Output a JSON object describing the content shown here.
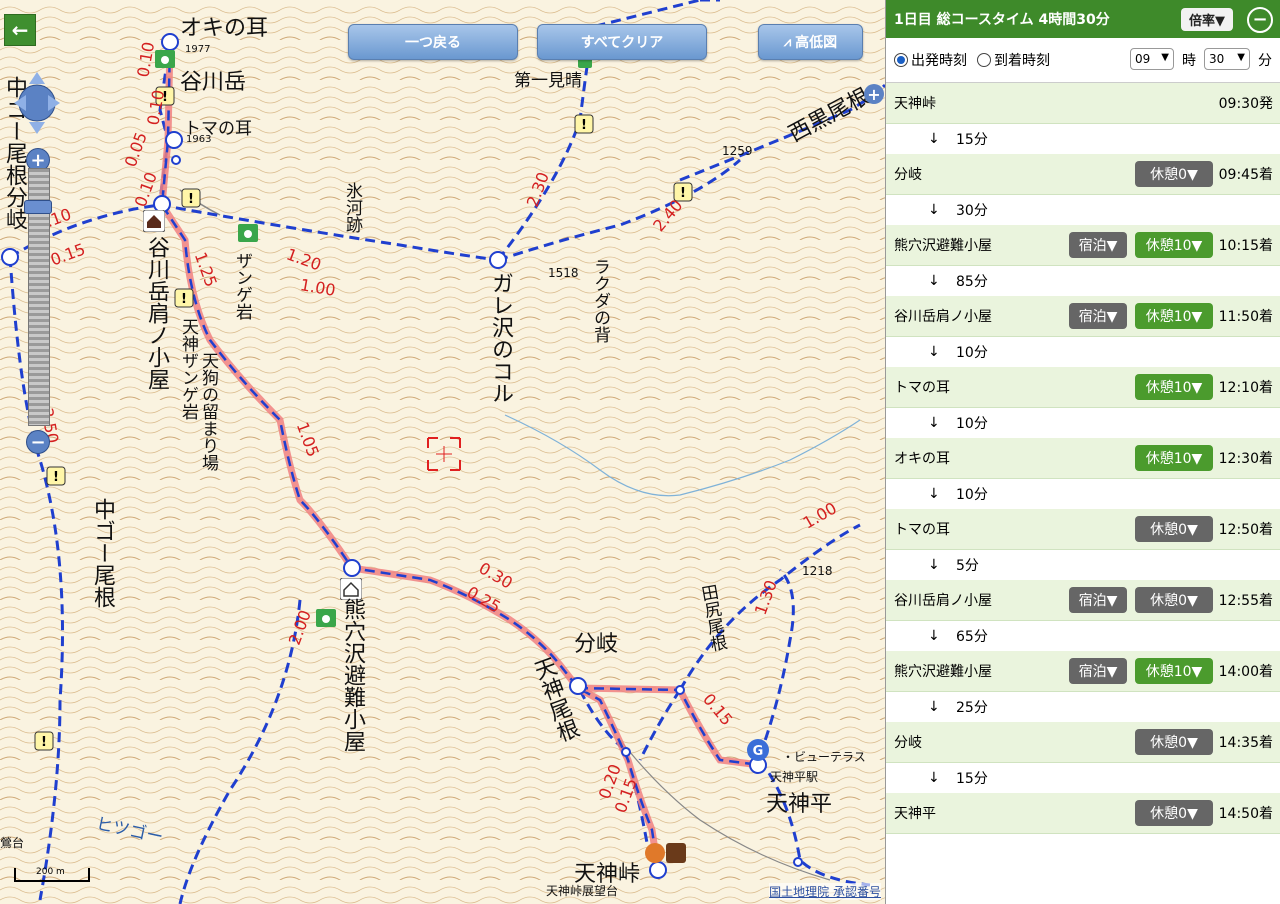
{
  "map": {
    "top_buttons": {
      "back": "一つ戻る",
      "clear": "すべてクリア",
      "profile": "高低図"
    },
    "labels": {
      "okinomimi": "オキの耳",
      "okinomimi_alt": "1977",
      "tanigawadake": "谷川岳",
      "tomanomimi": "トマの耳",
      "tomanomimi_alt": "1963",
      "naka_go_bunki": "中ゴー尾根分岐",
      "kata_hut": "谷川岳肩ノ小屋",
      "tengu": "天狗の留まり場",
      "tenjin_zange": "天神ザンゲ岩",
      "zange": "ザンゲ岩",
      "hyogaato": "氷河跡",
      "garesawa": "ガレ沢のコル",
      "rakuda": "ラクダの背",
      "alt_1518": "1518",
      "daiichi": "第一見晴",
      "nishikurone": "西黒尾根",
      "alt_1259": "1259",
      "kumaana": "熊穴沢避難小屋",
      "naka_go": "中ゴー尾根",
      "bunki": "分岐",
      "tenjin_one": "天神尾根",
      "tajiri": "田尻尾根",
      "alt_1218": "1218",
      "tenjindaira": "天神平",
      "tenjindaira_sta": "天神平駅",
      "view": "・ビューテラス",
      "tenjintoge": "天神峠",
      "tenjintoge_view": "天神峠展望台",
      "hitsugo": "ヒツゴー",
      "funadai": "鶯台"
    },
    "route_times": [
      "0.10",
      "0.10",
      "0.05",
      "0.10",
      "0.10",
      "0.15",
      "1.25",
      "1.20",
      "1.00",
      "2.30",
      "2.40",
      "1.05",
      "0.30",
      "0.25",
      "2.00",
      "0.15",
      "0.20",
      "0.15",
      "1.30",
      "1.00",
      "3.50"
    ],
    "scale_label": "200 m",
    "attribution": "国土地理院 承認番号"
  },
  "panel": {
    "header_title": "1日目 総コースタイム 4時間30分",
    "ratio_label": "倍率▼",
    "collapse_icon": "−",
    "depart_label": "出発時刻",
    "arrive_label": "到着時刻",
    "hour_value": "09",
    "hour_unit": "時",
    "minute_value": "30",
    "minute_unit": "分",
    "points": [
      {
        "name": "天神峠",
        "time": "09:30発",
        "stay": "",
        "rest": "",
        "rest_color": ""
      },
      {
        "name": "分岐",
        "time": "09:45着",
        "stay": "",
        "rest": "休憩0▼",
        "rest_color": "gray"
      },
      {
        "name": "熊穴沢避難小屋",
        "time": "10:15着",
        "stay": "宿泊▼",
        "rest": "休憩10▼",
        "rest_color": "green"
      },
      {
        "name": "谷川岳肩ノ小屋",
        "time": "11:50着",
        "stay": "宿泊▼",
        "rest": "休憩10▼",
        "rest_color": "green"
      },
      {
        "name": "トマの耳",
        "time": "12:10着",
        "stay": "",
        "rest": "休憩10▼",
        "rest_color": "green"
      },
      {
        "name": "オキの耳",
        "time": "12:30着",
        "stay": "",
        "rest": "休憩10▼",
        "rest_color": "green"
      },
      {
        "name": "トマの耳",
        "time": "12:50着",
        "stay": "",
        "rest": "休憩0▼",
        "rest_color": "gray"
      },
      {
        "name": "谷川岳肩ノ小屋",
        "time": "12:55着",
        "stay": "宿泊▼",
        "rest": "休憩0▼",
        "rest_color": "gray"
      },
      {
        "name": "熊穴沢避難小屋",
        "time": "14:00着",
        "stay": "宿泊▼",
        "rest": "休憩10▼",
        "rest_color": "green"
      },
      {
        "name": "分岐",
        "time": "14:35着",
        "stay": "",
        "rest": "休憩0▼",
        "rest_color": "gray"
      },
      {
        "name": "天神平",
        "time": "14:50着",
        "stay": "",
        "rest": "休憩0▼",
        "rest_color": "gray"
      }
    ],
    "segments": [
      "15分",
      "30分",
      "85分",
      "10分",
      "10分",
      "10分",
      "5分",
      "65分",
      "25分",
      "15分"
    ],
    "arrow": "↓"
  }
}
